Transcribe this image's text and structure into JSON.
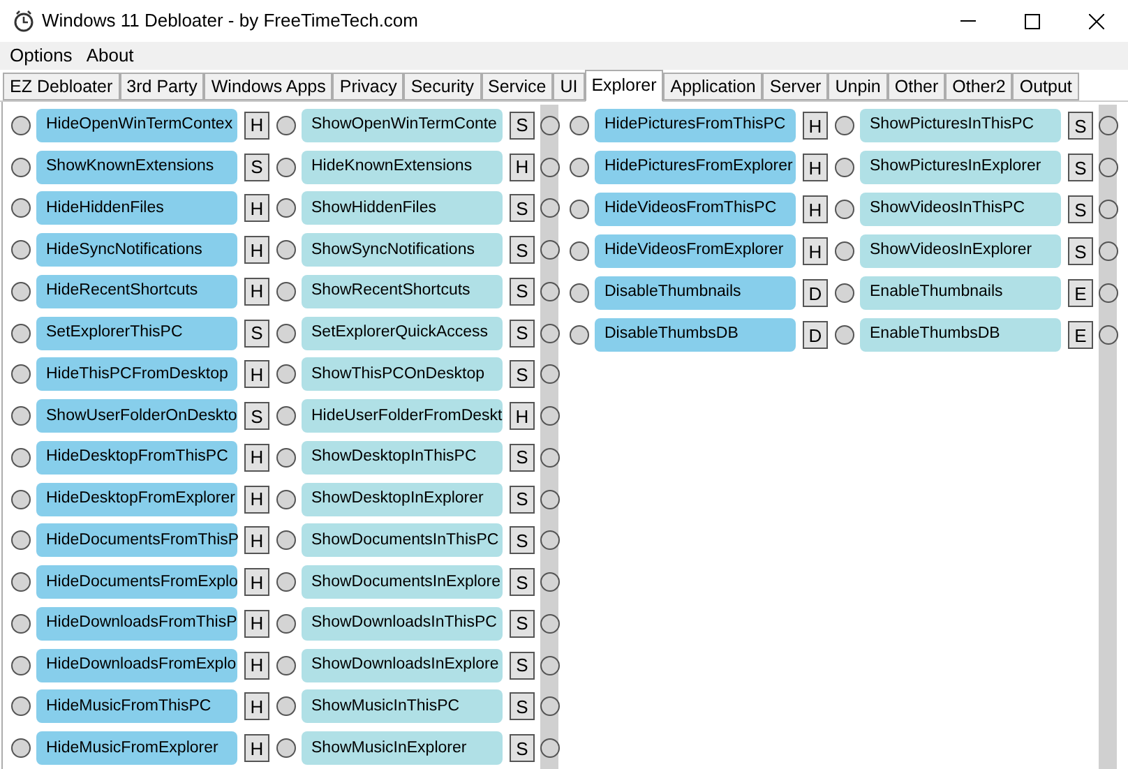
{
  "window": {
    "title": "Windows 11 Debloater - by FreeTimeTech.com"
  },
  "menu": [
    "Options",
    "About"
  ],
  "tabs": [
    {
      "label": "EZ Debloater",
      "selected": false
    },
    {
      "label": "3rd Party",
      "selected": false
    },
    {
      "label": "Windows Apps",
      "selected": false
    },
    {
      "label": "Privacy",
      "selected": false
    },
    {
      "label": "Security",
      "selected": false
    },
    {
      "label": "Service",
      "selected": false
    },
    {
      "label": "UI",
      "selected": false
    },
    {
      "label": "Explorer",
      "selected": true
    },
    {
      "label": "Application",
      "selected": false
    },
    {
      "label": "Server",
      "selected": false
    },
    {
      "label": "Unpin",
      "selected": false
    },
    {
      "label": "Other",
      "selected": false
    },
    {
      "label": "Other2",
      "selected": false
    },
    {
      "label": "Output",
      "selected": false
    }
  ],
  "groups": [
    {
      "rows": [
        {
          "on": false,
          "primary": {
            "on": false,
            "label": "HideOpenWinTermContex",
            "key": "H"
          },
          "secondary": {
            "on": false,
            "label": "ShowOpenWinTermConte",
            "key": "S"
          }
        },
        {
          "on": false,
          "primary": {
            "on": false,
            "label": "ShowKnownExtensions",
            "key": "S"
          },
          "secondary": {
            "on": false,
            "label": "HideKnownExtensions",
            "key": "H"
          }
        },
        {
          "on": false,
          "primary": {
            "on": false,
            "label": "HideHiddenFiles",
            "key": "H"
          },
          "secondary": {
            "on": false,
            "label": "ShowHiddenFiles",
            "key": "S"
          }
        },
        {
          "on": false,
          "primary": {
            "on": false,
            "label": "HideSyncNotifications",
            "key": "H"
          },
          "secondary": {
            "on": false,
            "label": "ShowSyncNotifications",
            "key": "S"
          }
        },
        {
          "on": false,
          "primary": {
            "on": false,
            "label": "HideRecentShortcuts",
            "key": "H"
          },
          "secondary": {
            "on": false,
            "label": "ShowRecentShortcuts",
            "key": "S"
          }
        },
        {
          "on": false,
          "primary": {
            "on": false,
            "label": "SetExplorerThisPC",
            "key": "S"
          },
          "secondary": {
            "on": false,
            "label": "SetExplorerQuickAccess",
            "key": "S"
          }
        },
        {
          "on": false,
          "primary": {
            "on": false,
            "label": "HideThisPCFromDesktop",
            "key": "H"
          },
          "secondary": {
            "on": false,
            "label": "ShowThisPCOnDesktop",
            "key": "S"
          }
        },
        {
          "on": false,
          "primary": {
            "on": false,
            "label": "ShowUserFolderOnDeskto",
            "key": "S"
          },
          "secondary": {
            "on": false,
            "label": "HideUserFolderFromDeskt",
            "key": "H"
          }
        },
        {
          "on": false,
          "primary": {
            "on": false,
            "label": "HideDesktopFromThisPC",
            "key": "H"
          },
          "secondary": {
            "on": false,
            "label": "ShowDesktopInThisPC",
            "key": "S"
          }
        },
        {
          "on": false,
          "primary": {
            "on": false,
            "label": "HideDesktopFromExplorer",
            "key": "H"
          },
          "secondary": {
            "on": false,
            "label": "ShowDesktopInExplorer",
            "key": "S"
          }
        },
        {
          "on": false,
          "primary": {
            "on": false,
            "label": "HideDocumentsFromThisP",
            "key": "H"
          },
          "secondary": {
            "on": false,
            "label": "ShowDocumentsInThisPC",
            "key": "S"
          }
        },
        {
          "on": false,
          "primary": {
            "on": false,
            "label": "HideDocumentsFromExplo",
            "key": "H"
          },
          "secondary": {
            "on": false,
            "label": "ShowDocumentsInExplore",
            "key": "S"
          }
        },
        {
          "on": false,
          "primary": {
            "on": false,
            "label": "HideDownloadsFromThisP",
            "key": "H"
          },
          "secondary": {
            "on": false,
            "label": "ShowDownloadsInThisPC",
            "key": "S"
          }
        },
        {
          "on": false,
          "primary": {
            "on": false,
            "label": "HideDownloadsFromExplo",
            "key": "H"
          },
          "secondary": {
            "on": false,
            "label": "ShowDownloadsInExplore",
            "key": "S"
          }
        },
        {
          "on": false,
          "primary": {
            "on": false,
            "label": "HideMusicFromThisPC",
            "key": "H"
          },
          "secondary": {
            "on": false,
            "label": "ShowMusicInThisPC",
            "key": "S"
          }
        },
        {
          "on": false,
          "primary": {
            "on": false,
            "label": "HideMusicFromExplorer",
            "key": "H"
          },
          "secondary": {
            "on": false,
            "label": "ShowMusicInExplorer",
            "key": "S"
          }
        }
      ]
    },
    {
      "rows": [
        {
          "on": false,
          "primary": {
            "on": false,
            "label": "HidePicturesFromThisPC",
            "key": "H"
          },
          "secondary": {
            "on": false,
            "label": "ShowPicturesInThisPC",
            "key": "S"
          }
        },
        {
          "on": false,
          "primary": {
            "on": false,
            "label": "HidePicturesFromExplorer",
            "key": "H"
          },
          "secondary": {
            "on": false,
            "label": "ShowPicturesInExplorer",
            "key": "S"
          }
        },
        {
          "on": false,
          "primary": {
            "on": false,
            "label": "HideVideosFromThisPC",
            "key": "H"
          },
          "secondary": {
            "on": false,
            "label": "ShowVideosInThisPC",
            "key": "S"
          }
        },
        {
          "on": false,
          "primary": {
            "on": false,
            "label": "HideVideosFromExplorer",
            "key": "H"
          },
          "secondary": {
            "on": false,
            "label": "ShowVideosInExplorer",
            "key": "S"
          }
        },
        {
          "on": false,
          "primary": {
            "on": false,
            "label": "DisableThumbnails",
            "key": "D"
          },
          "secondary": {
            "on": false,
            "label": "EnableThumbnails",
            "key": "E"
          }
        },
        {
          "on": false,
          "primary": {
            "on": false,
            "label": "DisableThumbsDB",
            "key": "D"
          },
          "secondary": {
            "on": false,
            "label": "EnableThumbsDB",
            "key": "E"
          }
        }
      ]
    }
  ]
}
